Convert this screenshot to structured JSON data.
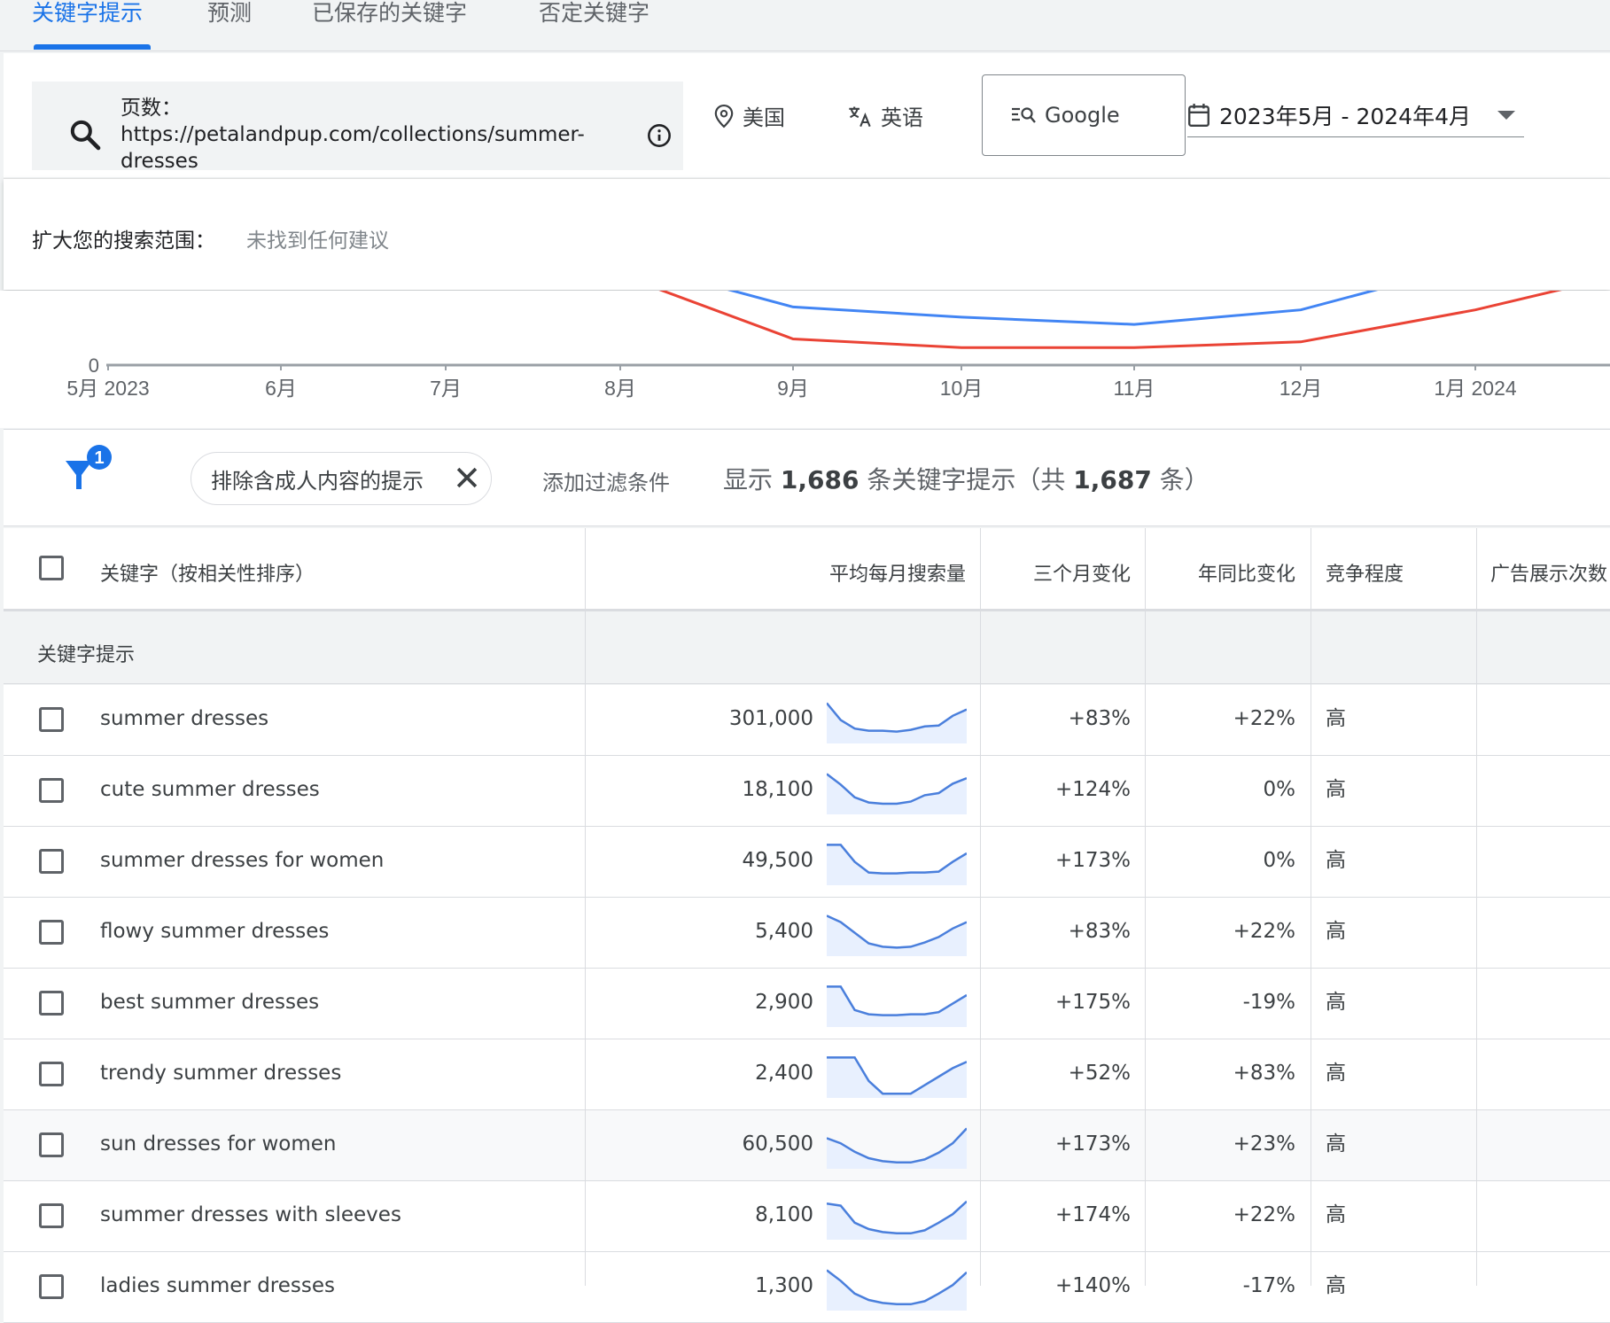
{
  "tabs": [
    {
      "label": "关键字提示",
      "active": true
    },
    {
      "label": "预测",
      "active": false
    },
    {
      "label": "已保存的关键字",
      "active": false
    },
    {
      "label": "否定关键字",
      "active": false
    }
  ],
  "search": {
    "label": "页数：",
    "url_line1": "https://petalandpup.com/collections/summer-",
    "url_line2": "dresses"
  },
  "location": "美国",
  "language": "英语",
  "network": "Google",
  "date_range": "2023年5月 - 2024年4月",
  "broaden": {
    "label": "扩大您的搜索范围：",
    "value": "未找到任何建议"
  },
  "chart_data": {
    "type": "line",
    "x": [
      "5月 2023",
      "6月",
      "7月",
      "8月",
      "9月",
      "10月",
      "11月",
      "12月",
      "1月 2024"
    ],
    "y_tick_zero": "0",
    "colors": {
      "series_a": "#4285f4",
      "series_b": "#ea4335"
    },
    "series": [
      {
        "values": [
          null,
          null,
          null,
          0.72,
          0.4,
          0.33,
          0.28,
          0.38,
          0.7,
          0.95
        ]
      },
      {
        "values": [
          null,
          null,
          null,
          0.62,
          0.18,
          0.12,
          0.12,
          0.16,
          0.38,
          0.6
        ]
      }
    ]
  },
  "filter": {
    "badge": "1",
    "chip_label": "排除含成人内容的提示",
    "add_filter": "添加过滤条件",
    "result_prefix": "显示 ",
    "result_shown": "1,686",
    "result_mid": " 条关键字提示（共 ",
    "result_total": "1,687",
    "result_suffix": " 条）"
  },
  "table": {
    "headers": {
      "keyword": "关键字（按相关性排序）",
      "avg_monthly": "平均每月搜索量",
      "three_month": "三个月变化",
      "yoy": "年同比变化",
      "competition": "竞争程度",
      "impressions": "广告展示次数"
    },
    "section_label": "关键字提示",
    "rows": [
      {
        "keyword": "summer dresses",
        "volume": "301,000",
        "three_month": "+83%",
        "yoy": "+22%",
        "competition": "高",
        "trend": [
          0.95,
          0.55,
          0.35,
          0.3,
          0.3,
          0.28,
          0.32,
          0.4,
          0.42,
          0.65,
          0.8
        ],
        "highlight": false
      },
      {
        "keyword": "cute summer dresses",
        "volume": "18,100",
        "three_month": "+124%",
        "yoy": "0%",
        "competition": "高",
        "trend": [
          0.95,
          0.7,
          0.4,
          0.28,
          0.25,
          0.25,
          0.3,
          0.45,
          0.5,
          0.72,
          0.85
        ],
        "highlight": false
      },
      {
        "keyword": "summer dresses for women",
        "volume": "49,500",
        "three_month": "+173%",
        "yoy": "0%",
        "competition": "高",
        "trend": [
          0.95,
          0.95,
          0.55,
          0.3,
          0.28,
          0.28,
          0.3,
          0.3,
          0.32,
          0.55,
          0.75
        ],
        "highlight": false
      },
      {
        "keyword": "flowy summer dresses",
        "volume": "5,400",
        "three_month": "+83%",
        "yoy": "+22%",
        "competition": "高",
        "trend": [
          0.95,
          0.8,
          0.55,
          0.3,
          0.22,
          0.2,
          0.22,
          0.32,
          0.45,
          0.65,
          0.8
        ],
        "highlight": false
      },
      {
        "keyword": "best summer dresses",
        "volume": "2,900",
        "three_month": "+175%",
        "yoy": "-19%",
        "competition": "高",
        "trend": [
          0.95,
          0.95,
          0.4,
          0.3,
          0.28,
          0.28,
          0.3,
          0.3,
          0.35,
          0.55,
          0.75
        ],
        "highlight": false
      },
      {
        "keyword": "trendy summer dresses",
        "volume": "2,400",
        "three_month": "+52%",
        "yoy": "+83%",
        "competition": "高",
        "trend": [
          0.95,
          0.95,
          0.95,
          0.4,
          0.1,
          0.1,
          0.1,
          0.3,
          0.5,
          0.7,
          0.85
        ],
        "highlight": false
      },
      {
        "keyword": "sun dresses for women",
        "volume": "60,500",
        "three_month": "+173%",
        "yoy": "+23%",
        "competition": "高",
        "trend": [
          0.72,
          0.6,
          0.4,
          0.25,
          0.18,
          0.15,
          0.15,
          0.22,
          0.38,
          0.6,
          0.95
        ],
        "highlight": true
      },
      {
        "keyword": "summer dresses with sleeves",
        "volume": "8,100",
        "three_month": "+174%",
        "yoy": "+22%",
        "competition": "高",
        "trend": [
          0.85,
          0.8,
          0.4,
          0.25,
          0.18,
          0.15,
          0.15,
          0.22,
          0.4,
          0.6,
          0.9
        ],
        "highlight": false
      },
      {
        "keyword": "ladies summer dresses",
        "volume": "1,300",
        "three_month": "+140%",
        "yoy": "-17%",
        "competition": "高",
        "trend": [
          0.95,
          0.7,
          0.4,
          0.25,
          0.18,
          0.15,
          0.15,
          0.22,
          0.4,
          0.6,
          0.9
        ],
        "highlight": false
      }
    ]
  }
}
